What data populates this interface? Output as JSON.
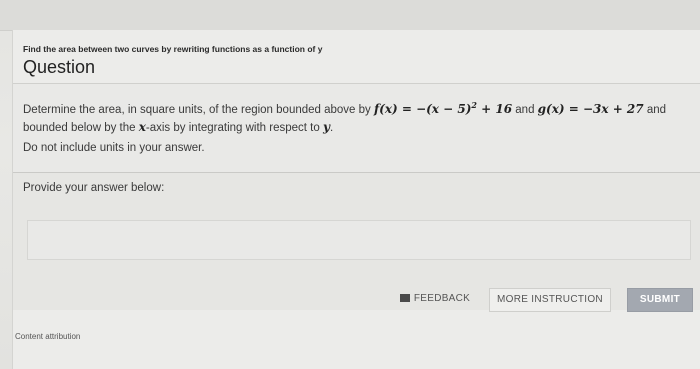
{
  "header": {
    "subtitle": "Find the area between two curves by rewriting functions as a function of y",
    "title": "Question"
  },
  "question": {
    "text_before_f": "Determine the area, in square units, of the region bounded above by ",
    "f_expr": "f(x) = −(x − 5)",
    "f_exp": "2",
    "f_rest": " + 16",
    "text_and": " and ",
    "g_expr": "g(x) = −3x + 27",
    "text_after_g": " and bounded below by the ",
    "x_axis_var": "x",
    "text_axis": "-axis by integrating with respect to ",
    "y_var": "y",
    "text_end": ".",
    "note": "Do not include units in your answer."
  },
  "answer": {
    "label": "Provide your answer below:",
    "value": ""
  },
  "buttons": {
    "feedback": "FEEDBACK",
    "more_instruction": "MORE INSTRUCTION",
    "submit": "SUBMIT"
  },
  "footer": {
    "attribution": "Content attribution"
  },
  "icons": {
    "feedback": "feedback-icon"
  }
}
